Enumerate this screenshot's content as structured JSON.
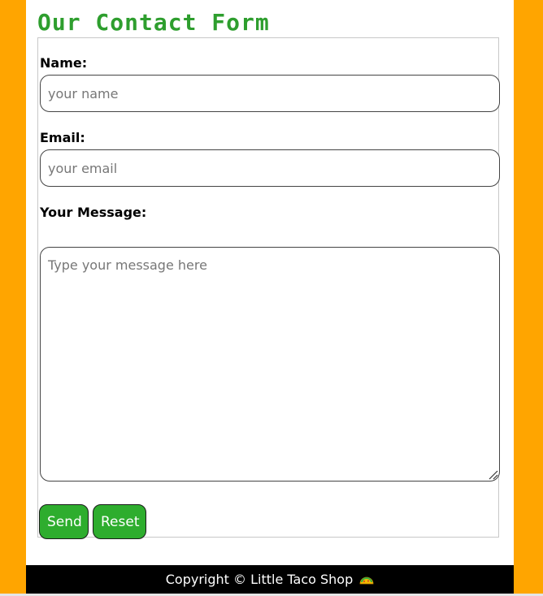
{
  "page": {
    "title": "Our Contact Form"
  },
  "form": {
    "name": {
      "label": "Name:",
      "placeholder": "your name",
      "value": ""
    },
    "email": {
      "label": "Email:",
      "placeholder": "your email",
      "value": ""
    },
    "message": {
      "label": "Your Message:",
      "placeholder": "Type your message here",
      "value": ""
    },
    "send_label": "Send",
    "reset_label": "Reset"
  },
  "footer": {
    "text": "Copyright © Little Taco Shop",
    "icon": "taco-icon"
  },
  "colors": {
    "background": "#FFA500",
    "title": "#2E9E2E",
    "button": "#2EAD2E",
    "footer": "#000000"
  }
}
